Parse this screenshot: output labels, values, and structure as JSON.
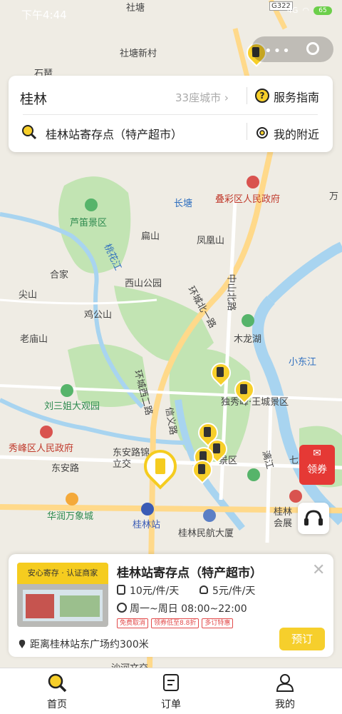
{
  "status_bar": {
    "time": "下午4:44",
    "network": "4G",
    "battery": "65"
  },
  "search_card": {
    "city": "桂林",
    "city_count": "33座城市 ›",
    "service_guide": "服务指南",
    "search_value": "桂林站寄存点（特产超市）",
    "nearby": "我的附近"
  },
  "map_labels": [
    {
      "text": "社塘",
      "kind": "plain"
    },
    {
      "text": "社塘新村",
      "kind": "plain"
    },
    {
      "text": "石琶",
      "kind": "plain"
    },
    {
      "text": "G322",
      "kind": "road"
    },
    {
      "text": "长塘",
      "kind": "blue"
    },
    {
      "text": "叠彩区人民政府",
      "kind": "red"
    },
    {
      "text": "芦笛景区",
      "kind": "green"
    },
    {
      "text": "扁山",
      "kind": "plain"
    },
    {
      "text": "凤凰山",
      "kind": "plain"
    },
    {
      "text": "桃花江",
      "kind": "blue"
    },
    {
      "text": "合家",
      "kind": "plain"
    },
    {
      "text": "西山公园",
      "kind": "plain"
    },
    {
      "text": "尖山",
      "kind": "plain"
    },
    {
      "text": "鸡公山",
      "kind": "plain"
    },
    {
      "text": "环城北一路",
      "kind": "plain"
    },
    {
      "text": "中山北路",
      "kind": "plain"
    },
    {
      "text": "老庙山",
      "kind": "plain"
    },
    {
      "text": "木龙湖",
      "kind": "plain"
    },
    {
      "text": "小东江",
      "kind": "blue"
    },
    {
      "text": "独秀峰·王城景区",
      "kind": "plain"
    },
    {
      "text": "环城西二路",
      "kind": "plain"
    },
    {
      "text": "刘三姐大观园",
      "kind": "green"
    },
    {
      "text": "信义路",
      "kind": "plain"
    },
    {
      "text": "秀峰区人民政府",
      "kind": "red"
    },
    {
      "text": "东安路",
      "kind": "plain"
    },
    {
      "text": "东安路锦立交",
      "kind": "plain"
    },
    {
      "text": "景区",
      "kind": "plain"
    },
    {
      "text": "华润万象城",
      "kind": "green"
    },
    {
      "text": "桂林站",
      "kind": "purple"
    },
    {
      "text": "桂林民航大厦",
      "kind": "plain"
    },
    {
      "text": "桂林会展",
      "kind": "plain"
    },
    {
      "text": "万",
      "kind": "plain"
    },
    {
      "text": "七",
      "kind": "plain"
    },
    {
      "text": "漓江",
      "kind": "plain"
    },
    {
      "text": "沙河文交",
      "kind": "plain"
    }
  ],
  "floating": {
    "coupon": "领券"
  },
  "shop_card": {
    "photo_banner": "安心寄存 · 认证商家",
    "title": "桂林站寄存点（特产超市）",
    "price_large": "10元/件/天",
    "price_small": "5元/件/天",
    "hours": "周一~周日 08:00~22:00",
    "tags": [
      "免费取消",
      "领券低至8.8折",
      "多订特惠"
    ],
    "distance": "距离桂林站东广场约300米",
    "book_label": "预订"
  },
  "tabbar": {
    "items": [
      {
        "label": "首页",
        "icon": "search-icon"
      },
      {
        "label": "订单",
        "icon": "order-icon"
      },
      {
        "label": "我的",
        "icon": "user-icon"
      }
    ]
  },
  "colors": {
    "accent": "#f7cf2a",
    "water": "#a8d4f0",
    "park": "#bfe3b0",
    "road": "#ffd98a"
  }
}
